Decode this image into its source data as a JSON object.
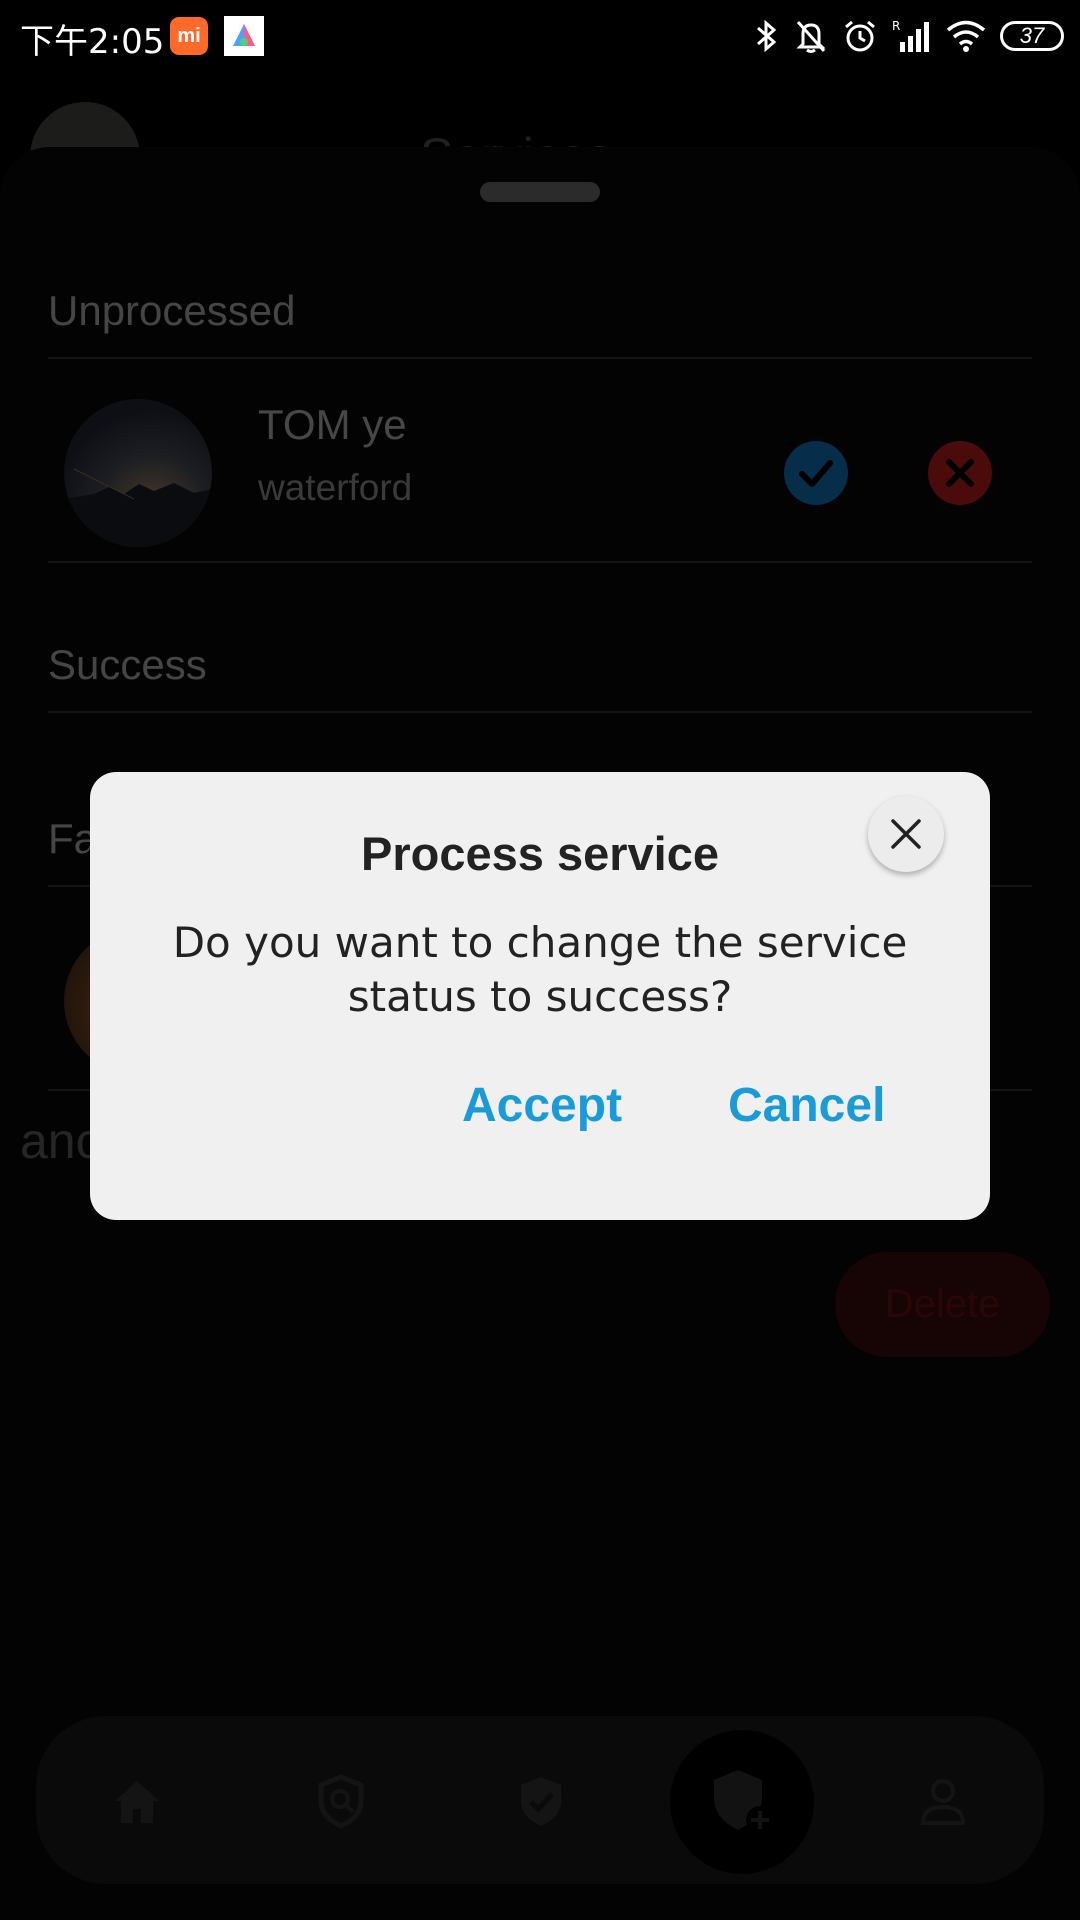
{
  "status_bar": {
    "time": "下午2:05",
    "mi_badge": "mi",
    "battery": "37",
    "icons": [
      "bluetooth-icon",
      "bell-off-icon",
      "alarm-icon",
      "signal-icon",
      "wifi-icon",
      "battery-icon"
    ]
  },
  "background": {
    "page_title": "Services",
    "sections": {
      "unprocessed": "Unprocessed",
      "success": "Success",
      "failed": "Failed"
    },
    "unprocessed_item": {
      "name": "TOM ye",
      "location": "waterford"
    },
    "partial_text": "anc",
    "delete_label": "Delete",
    "nav_icons": [
      "home-icon",
      "shield-search-icon",
      "shield-check-icon",
      "shield-add-icon",
      "person-icon"
    ]
  },
  "dialog": {
    "title": "Process service",
    "message": "Do you want to change the service status to success?",
    "accept_label": "Accept",
    "cancel_label": "Cancel"
  },
  "colors": {
    "dialog_bg": "#f0f0f0",
    "dialog_action": "#1a9bd9",
    "accept_dim": "#062d4a",
    "reject_dim": "#4b0b0b"
  }
}
